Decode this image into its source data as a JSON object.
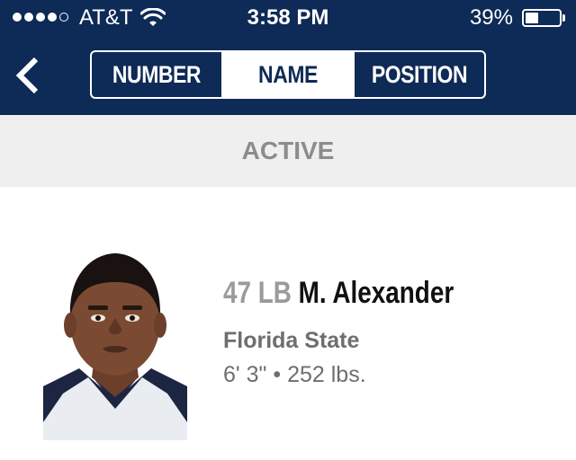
{
  "status_bar": {
    "carrier": "AT&T",
    "time": "3:58 PM",
    "battery": "39%",
    "battery_level": 0.39,
    "signal_bars_filled": 4,
    "signal_bars_total": 5,
    "wifi_icon": "wifi-icon"
  },
  "nav": {
    "back_icon": "chevron-left-icon",
    "segments": [
      {
        "label": "NUMBER",
        "active": false
      },
      {
        "label": "NAME",
        "active": true
      },
      {
        "label": "POSITION",
        "active": false
      }
    ]
  },
  "section": {
    "title": "ACTIVE"
  },
  "player": {
    "number_position": "47 LB",
    "name": "M. Alexander",
    "college": "Florida State",
    "height": "6' 3\"",
    "separator": "•",
    "weight": "252 lbs."
  },
  "colors": {
    "header_bg": "#0e2a56",
    "section_bg": "#efefef",
    "muted_text": "#6e6e6e"
  }
}
